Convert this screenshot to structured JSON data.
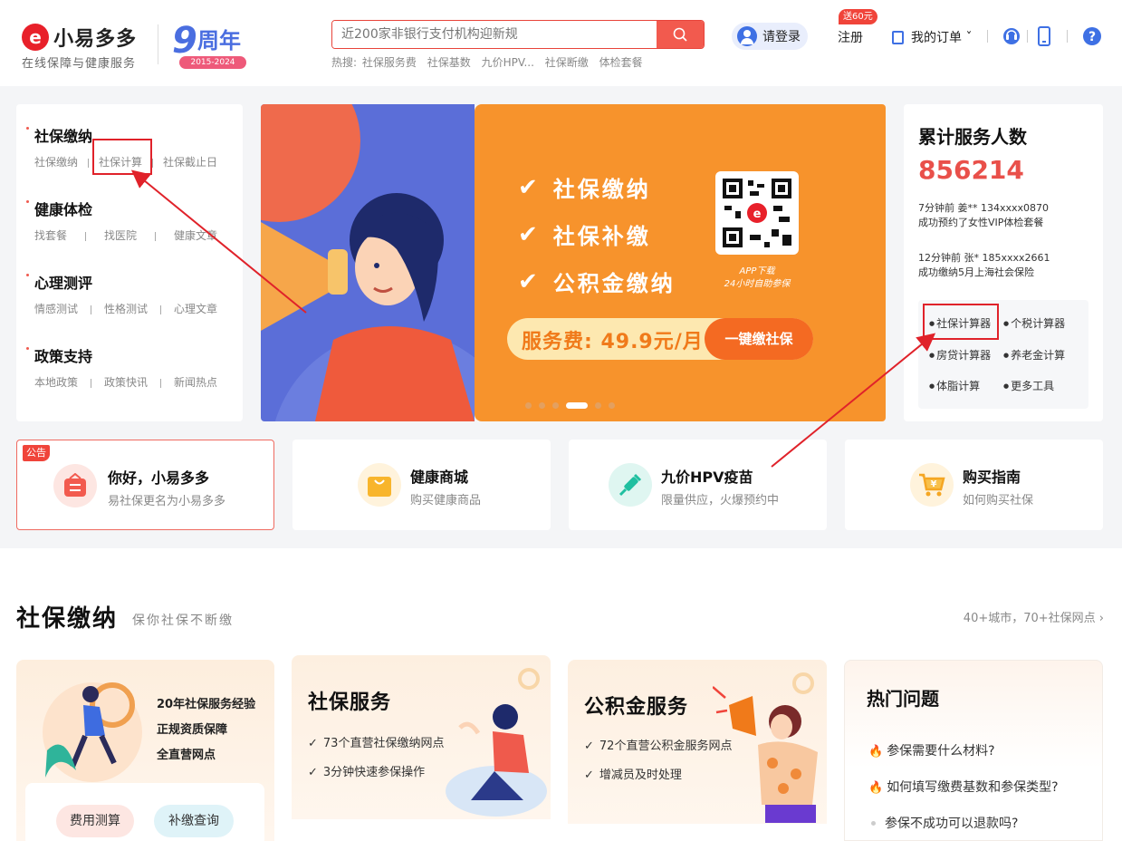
{
  "brand": {
    "name": "小易多多",
    "tagline": "在线保障与健康服务",
    "logo_letter": "e",
    "anniversary_big": "9",
    "anniversary_word": "周年",
    "anniversary_years": "2015-2024"
  },
  "search": {
    "placeholder": "近200家非银行支付机构迎新规",
    "hot_label": "热搜:",
    "hot_terms": [
      "社保服务费",
      "社保基数",
      "九价HPV...",
      "社保断缴",
      "体检套餐"
    ]
  },
  "header": {
    "login": "请登录",
    "register": "注册",
    "register_badge": "送60元",
    "orders": "我的订单 ˇ"
  },
  "colors": {
    "accent": "#f0443a",
    "brand_blue": "#3e70e4",
    "banner_orange": "#f7932c"
  },
  "left_menu": [
    {
      "title": "社保缴纳",
      "links": [
        "社保缴纳",
        "社保计算",
        "社保截止日"
      ]
    },
    {
      "title": "健康体检",
      "links": [
        "找套餐",
        "找医院",
        "健康文章"
      ]
    },
    {
      "title": "心理测评",
      "links": [
        "情感测试",
        "性格测试",
        "心理文章"
      ]
    },
    {
      "title": "政策支持",
      "links": [
        "本地政策",
        "政策快讯",
        "新闻热点"
      ]
    }
  ],
  "banner": {
    "features": [
      "社保缴纳",
      "社保补缴",
      "公积金缴纳"
    ],
    "qr_caption_1": "APP下载",
    "qr_caption_2": "24小时自助参保",
    "price": "服务费: 49.9元/月",
    "cta": "一键缴社保",
    "active_slide": 4,
    "slide_count": 6
  },
  "stats": {
    "title": "累计服务人数",
    "count": "856214",
    "feed": [
      {
        "line1": "7分钟前 姜** 134xxxx0870",
        "line2": "成功预约了女性VIP体检套餐"
      },
      {
        "line1": "12分钟前 张* 185xxxx2661",
        "line2": "成功缴纳5月上海社会保险"
      }
    ],
    "tools": [
      "社保计算器",
      "个税计算器",
      "房贷计算器",
      "养老金计算",
      "体脂计算",
      "更多工具"
    ]
  },
  "cards": [
    {
      "tag": "公告",
      "title": "你好，小易多多",
      "sub": "易社保更名为小易多多"
    },
    {
      "title": "健康商城",
      "sub": "购买健康商品"
    },
    {
      "title": "九价HPV疫苗",
      "sub": "限量供应，火爆预约中"
    },
    {
      "title": "购买指南",
      "sub": "如何购买社保"
    }
  ],
  "section": {
    "title": "社保缴纳",
    "subtitle": "保你社保不断缴",
    "link": "40+城市，70+社保网点 ›"
  },
  "panel1": {
    "lines": [
      "20年社保服务经验",
      "正规资质保障",
      "全直营网点"
    ],
    "chips": [
      "费用测算",
      "补缴查询"
    ]
  },
  "panel2": {
    "title": "社保服务",
    "bullets": [
      "73个直营社保缴纳网点",
      "3分钟快速参保操作"
    ]
  },
  "panel3": {
    "title": "公积金服务",
    "bullets": [
      "72个直营公积金服务网点",
      "增减员及时处理"
    ]
  },
  "panel4": {
    "title": "热门问题",
    "faqs": [
      "参保需要什么材料?",
      "如何填写缴费基数和参保类型?",
      "参保不成功可以退款吗?"
    ]
  }
}
